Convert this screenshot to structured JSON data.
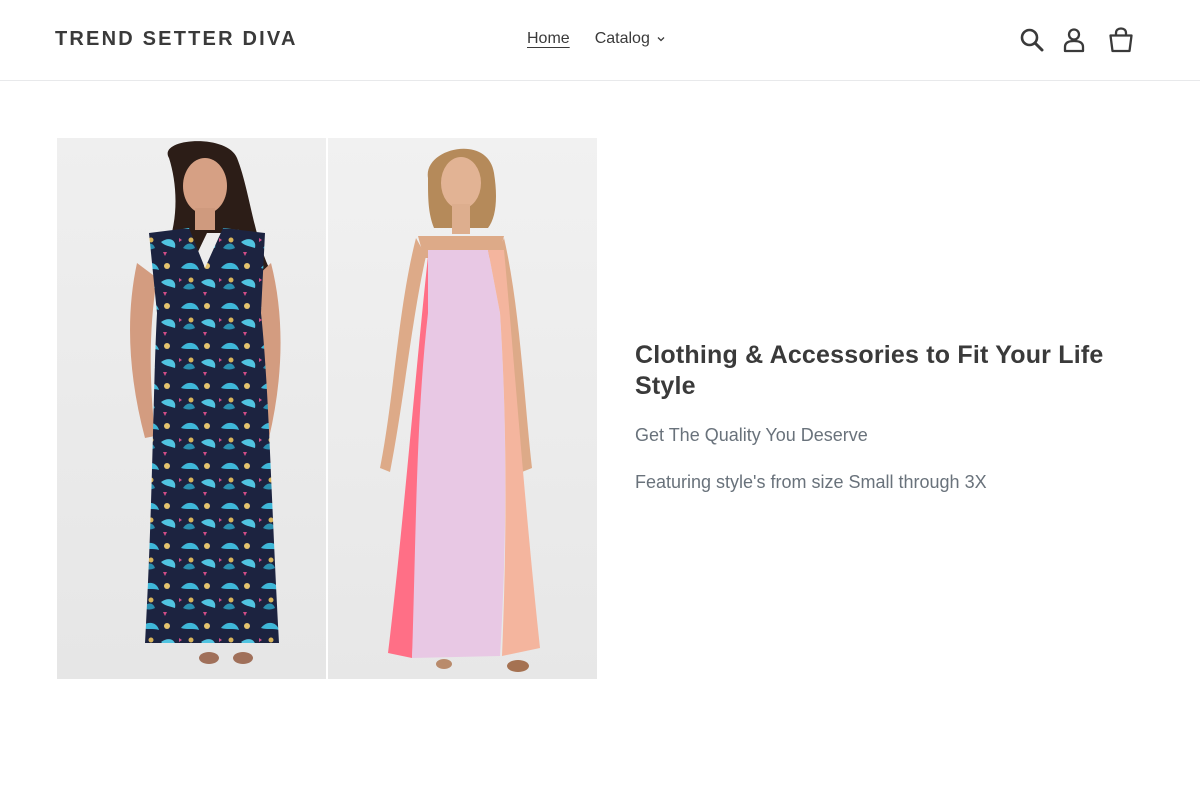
{
  "brand": {
    "name": "TREND SETTER DIVA"
  },
  "nav": {
    "items": [
      {
        "label": "Home"
      },
      {
        "label": "Catalog"
      }
    ]
  },
  "header_icons": [
    "search-icon",
    "account-icon",
    "cart-icon"
  ],
  "hero": {
    "heading": "Clothing & Accessories to Fit Your Life Style",
    "line1": "Get The Quality You Deserve",
    "line2": "Featuring style's from size Small through 3X"
  },
  "colors": {
    "text": "#3a3a3a",
    "muted": "#69727b",
    "border": "#e8e9eb",
    "panel_bg": "#efefef"
  }
}
